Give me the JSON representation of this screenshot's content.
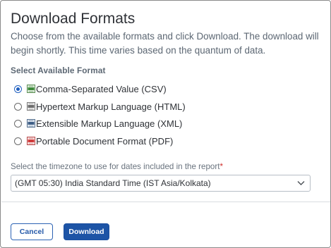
{
  "dialog": {
    "title": "Download Formats",
    "description": "Choose from the available formats and click Download. The download will begin shortly. This time varies based on the quantum of data."
  },
  "formats": {
    "section_label": "Select Available Format",
    "selected": "csv",
    "options": [
      {
        "id": "csv",
        "label": "Comma-Separated Value (CSV)",
        "icon": "csv-file-icon",
        "checked": true
      },
      {
        "id": "html",
        "label": "Hypertext Markup Language (HTML)",
        "icon": "html-file-icon",
        "checked": false
      },
      {
        "id": "xml",
        "label": "Extensible Markup Language (XML)",
        "icon": "xml-file-icon",
        "checked": false
      },
      {
        "id": "pdf",
        "label": "Portable Document Format (PDF)",
        "icon": "pdf-file-icon",
        "checked": false
      }
    ]
  },
  "timezone": {
    "label": "Select the timezone to use for dates included in the report",
    "required_marker": "*",
    "selected_value": "(GMT 05:30) India Standard Time (IST Asia/Kolkata)"
  },
  "actions": {
    "cancel_label": "Cancel",
    "download_label": "Download"
  },
  "colors": {
    "accent": "#1d54a6",
    "required": "#d0312d",
    "title_text": "#2f3237",
    "muted_text": "#5c6773"
  }
}
